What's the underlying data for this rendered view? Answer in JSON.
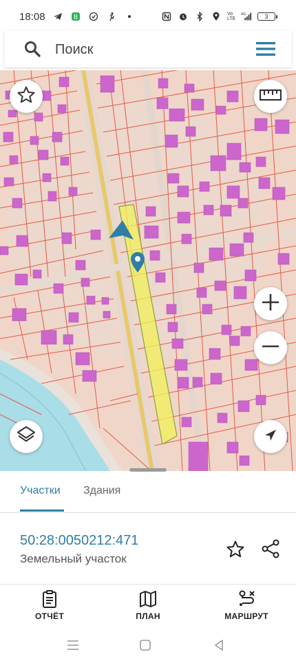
{
  "status_bar": {
    "time": "18:08",
    "battery_level": "3",
    "network": "4G",
    "volte": "Vo LTE"
  },
  "search": {
    "placeholder": "Поиск"
  },
  "tabs": [
    {
      "label": "Участки",
      "active": true
    },
    {
      "label": "Здания",
      "active": false
    }
  ],
  "parcel": {
    "cadastral_number": "50:28:0050212:471",
    "type": "Земельный участок"
  },
  "bottom_nav": {
    "report_label": "ОТЧЁТ",
    "plan_label": "ПЛАН",
    "route_label": "МАРШРУТ"
  },
  "colors": {
    "accent": "#2e7fa5",
    "parcel_highlight": "#f2f25a",
    "building": "#cc66cc",
    "parcel_border": "#e0463c",
    "water": "#a9dde7"
  },
  "icons": {
    "search": "search-icon",
    "menu": "hamburger-menu-icon",
    "favorite": "star-icon",
    "ruler": "ruler-icon",
    "zoom_in": "plus-icon",
    "zoom_out": "minus-icon",
    "layers": "layers-icon",
    "locate": "navigation-arrow-icon",
    "share": "share-icon"
  }
}
